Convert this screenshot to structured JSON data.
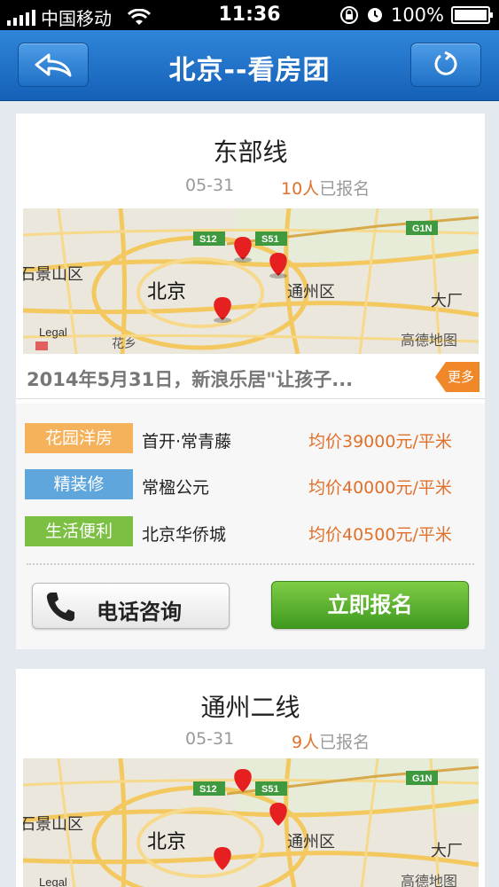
{
  "status_bar": {
    "carrier": "中国移动",
    "time": "11:36",
    "battery": "100%"
  },
  "nav": {
    "title": "北京--看房团",
    "back_icon": "back-arrow-icon",
    "refresh_icon": "refresh-icon"
  },
  "tours": [
    {
      "title": "东部线",
      "date": "05-31",
      "count": "10人",
      "count_suffix": "已报名",
      "map_labels": {
        "s12": "S12",
        "s51": "S51",
        "g1n": "G1N",
        "shijingshan": "石景山区",
        "beijing": "北京",
        "tongzhou": "通州区",
        "dachang": "大厂",
        "huaxiang": "花乡",
        "legal": "Legal",
        "gaode": "高德地图"
      },
      "news": "2014年5月31日，新浪乐居\"让孩子...",
      "more_label": "更多",
      "features": [
        {
          "tag": "花园洋房",
          "tag_color": "#f6b25a",
          "name": "首开·常青藤",
          "price": "均价39000元/平米"
        },
        {
          "tag": "精装修",
          "tag_color": "#5fa6dc",
          "name": "常楹公元",
          "price": "均价40000元/平米"
        },
        {
          "tag": "生活便利",
          "tag_color": "#7bc043",
          "name": "北京华侨城",
          "price": "均价40500元/平米"
        }
      ],
      "call_label": "电话咨询",
      "signup_label": "立即报名"
    },
    {
      "title": "通州二线",
      "date": "05-31",
      "count": "9人",
      "count_suffix": "已报名",
      "map_labels": {
        "s12": "S12",
        "s51": "S51",
        "g1n": "G1N",
        "shijingshan": "石景山区",
        "beijing": "北京",
        "tongzhou": "通州区",
        "dachang": "大厂",
        "legal": "Legal",
        "gaode": "高德地图"
      }
    }
  ],
  "colors": {
    "nav_blue": "#1f70c6",
    "accent_orange": "#e0702a",
    "signup_green": "#4fa82a"
  }
}
